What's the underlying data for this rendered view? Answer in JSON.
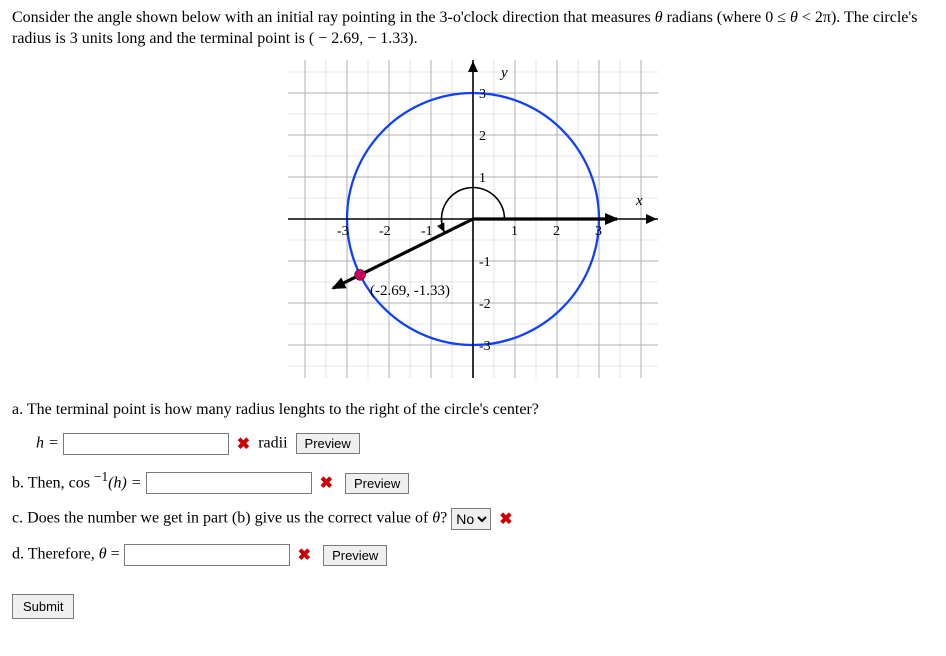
{
  "problem": {
    "line1_pre": "Consider the angle shown below with an initial ray pointing in the 3-o'clock direction that measures ",
    "theta": "θ",
    "line1_mid": " radians (where 0 ≤ ",
    "line1_mid2": " < 2π). The circle's radius is 3 units long and the terminal point is ",
    "point": "( − 2.69,  − 1.33)",
    "line1_end": "."
  },
  "chart_data": {
    "type": "unit-circle-plot",
    "radius": 3,
    "x_ticks": [
      -3,
      -2,
      -1,
      1,
      2,
      3
    ],
    "y_ticks": [
      -3,
      -2,
      -1,
      1,
      2,
      3
    ],
    "axis_labels": {
      "x": "x",
      "y": "y"
    },
    "terminal_point": {
      "x": -2.69,
      "y": -1.33,
      "label": "(-2.69, -1.33)"
    },
    "angle_arc_from_deg": 0,
    "angle_arc_to_deg": 206.3,
    "arc_radius": 0.75
  },
  "parts": {
    "a": {
      "text": "a. The terminal point is how many radius lenghts to the right of the circle's center?",
      "label_pre": "h = ",
      "unit": " radii",
      "preview": "Preview"
    },
    "b": {
      "label_pre": "b. Then, cos ",
      "label_sup": "−1",
      "label_post": "(h) = ",
      "preview": "Preview"
    },
    "c": {
      "text_pre": "c. Does the number we get in part (b) give us the correct value of ",
      "text_post": "? ",
      "selected": "No"
    },
    "d": {
      "label_pre": "d. Therefore, ",
      "label_mid": " = ",
      "preview": "Preview"
    }
  },
  "buttons": {
    "submit": "Submit"
  },
  "marks": {
    "wrong": "✖"
  }
}
